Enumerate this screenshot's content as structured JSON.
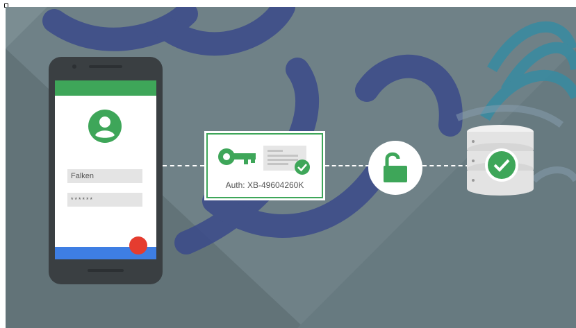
{
  "phone": {
    "username_value": "Falken",
    "password_value": "******"
  },
  "auth_card": {
    "label": "Auth: XB-49604260K"
  },
  "icons": {
    "avatar": "account-circle-icon",
    "fab": "red-action-button",
    "key": "key-icon",
    "document": "document-check-icon",
    "lock": "unlocked-padlock-icon",
    "database": "database-check-icon"
  },
  "colors": {
    "background": "#6f8187",
    "green": "#3ea659",
    "blue": "#3e7ee3",
    "red": "#e53c2f",
    "watermark": "#3b4a8a",
    "teal": "#3a8aa0"
  }
}
